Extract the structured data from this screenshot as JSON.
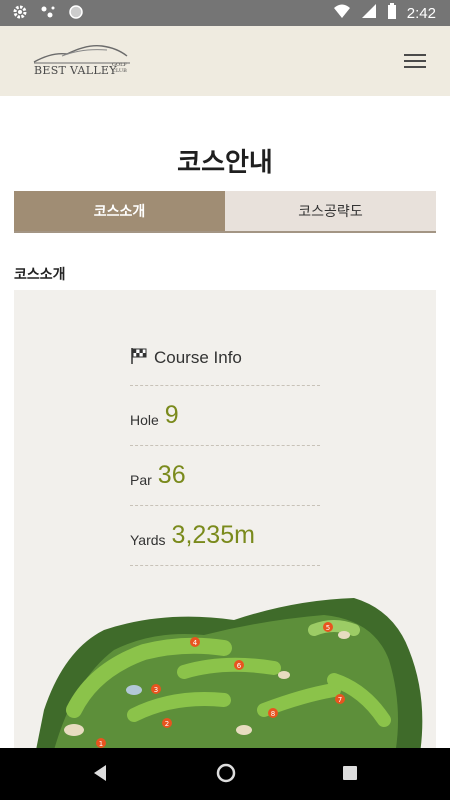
{
  "status_bar": {
    "time": "2:42",
    "icons": [
      "gear-icon",
      "connection-icon",
      "circle-icon",
      "wifi-icon",
      "signal-icon",
      "battery-icon"
    ]
  },
  "header": {
    "logo_text": "BEST VALLEY",
    "logo_sub_line1": "GOLF",
    "logo_sub_line2": "CLUB",
    "menu_icon": "hamburger-menu-icon"
  },
  "page": {
    "title": "코스안내"
  },
  "tabs": [
    {
      "label": "코스소개",
      "active": true
    },
    {
      "label": "코스공략도",
      "active": false
    }
  ],
  "section": {
    "label": "코스소개"
  },
  "course_info": {
    "title": "Course Info",
    "flag_icon": "checkered-flag-icon",
    "rows": [
      {
        "label": "Hole",
        "value": "9"
      },
      {
        "label": "Par",
        "value": "36"
      },
      {
        "label": "Yards",
        "value": "3,235m"
      }
    ]
  },
  "course_map": {
    "hole_markers": [
      "1",
      "2",
      "3",
      "4",
      "5",
      "6",
      "7",
      "8"
    ]
  },
  "colors": {
    "status_bar": "#757575",
    "header_bg": "#efebe0",
    "tab_active": "#a08d74",
    "tab_inactive": "#e8e1db",
    "value_green": "#7a8a1c",
    "panel_bg": "#f2f0ec"
  },
  "nav_bar": {
    "back_icon": "back-triangle-icon",
    "home_icon": "home-circle-icon",
    "recents_icon": "recents-square-icon"
  }
}
